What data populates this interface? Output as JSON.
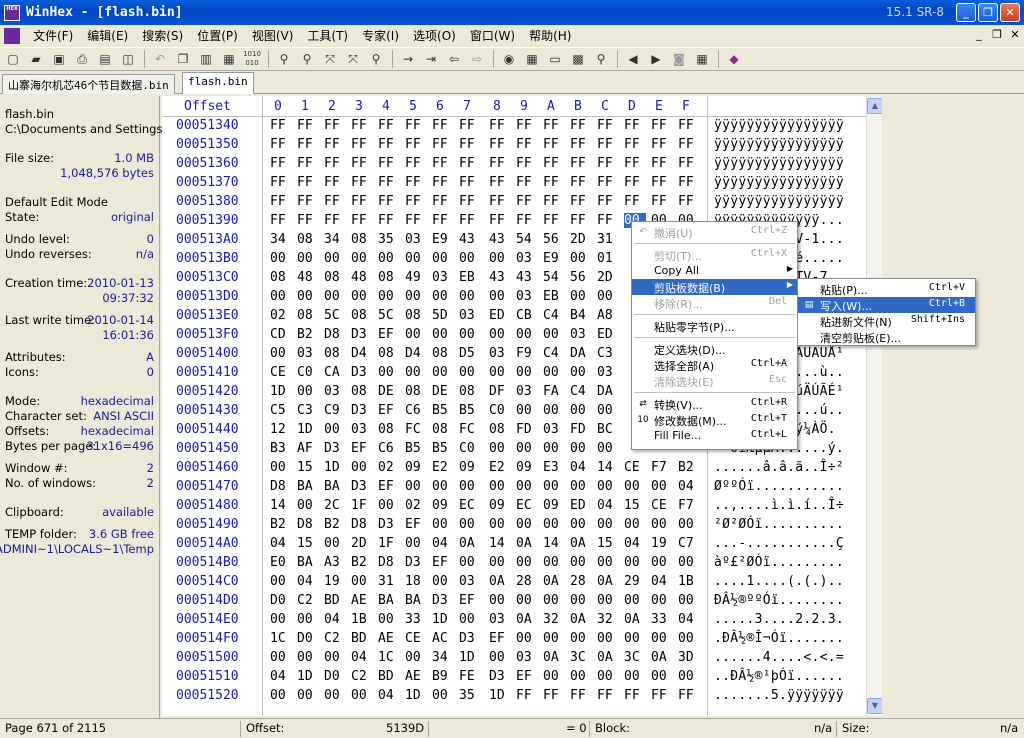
{
  "window": {
    "title": "WinHex - [flash.bin]",
    "version": "15.1 SR-8",
    "app_icon_text": "HEX",
    "minimize": "_",
    "maximize": "❐",
    "close": "✕"
  },
  "menubar": {
    "items": [
      "文件(F)",
      "编辑(E)",
      "搜索(S)",
      "位置(P)",
      "视图(V)",
      "工具(T)",
      "专家(I)",
      "选项(O)",
      "窗口(W)",
      "帮助(H)"
    ],
    "mdi_minimize": "_",
    "mdi_restore": "❐",
    "mdi_close": "✕"
  },
  "tabs": [
    {
      "label": "山寨海尔机芯46个节目数据.bin",
      "active": false
    },
    {
      "label": "flash.bin",
      "active": true
    }
  ],
  "left_panel": {
    "filename": "flash.bin",
    "path": "C:\\Documents and Settings",
    "file_size_label": "File size:",
    "file_size_mb": "1.0 MB",
    "file_size_bytes": "1,048,576 bytes",
    "edit_mode": "Default Edit Mode",
    "state_label": "State:",
    "state_value": "original",
    "undo_level_label": "Undo level:",
    "undo_level_value": "0",
    "undo_reverses_label": "Undo reverses:",
    "undo_reverses_value": "n/a",
    "creation_label": "Creation time:",
    "creation_date": "2010-01-13",
    "creation_time": "09:37:32",
    "lastwrite_label": "Last write time:",
    "lastwrite_date": "2010-01-14",
    "lastwrite_time": "16:01:36",
    "attributes_label": "Attributes:",
    "attributes_value": "A",
    "icons_label": "Icons:",
    "icons_value": "0",
    "mode_label": "Mode:",
    "mode_value": "hexadecimal",
    "charset_label": "Character set:",
    "charset_value": "ANSI ASCII",
    "offsets_label": "Offsets:",
    "offsets_value": "hexadecimal",
    "bpp_label": "Bytes per page:",
    "bpp_value": "31x16=496",
    "window_no_label": "Window #:",
    "window_no_value": "2",
    "no_windows_label": "No. of windows:",
    "no_windows_value": "2",
    "clipboard_label": "Clipboard:",
    "clipboard_value": "available",
    "temp_label": "TEMP folder:",
    "temp_free": "3.6 GB free",
    "temp_path": "ADMINI~1\\LOCALS~1\\Temp"
  },
  "hex": {
    "offset_header": "Offset",
    "col_headers": [
      "0",
      "1",
      "2",
      "3",
      "4",
      "5",
      "6",
      "7",
      "8",
      "9",
      "A",
      "B",
      "C",
      "D",
      "E",
      "F"
    ],
    "rows": [
      {
        "off": "00051340",
        "bytes": "FF FF FF FF FF FF FF FF FF FF FF FF FF FF FF FF",
        "ascii": "ÿÿÿÿÿÿÿÿÿÿÿÿÿÿÿÿ"
      },
      {
        "off": "00051350",
        "bytes": "FF FF FF FF FF FF FF FF FF FF FF FF FF FF FF FF",
        "ascii": "ÿÿÿÿÿÿÿÿÿÿÿÿÿÿÿÿ"
      },
      {
        "off": "00051360",
        "bytes": "FF FF FF FF FF FF FF FF FF FF FF FF FF FF FF FF",
        "ascii": "ÿÿÿÿÿÿÿÿÿÿÿÿÿÿÿÿ"
      },
      {
        "off": "00051370",
        "bytes": "FF FF FF FF FF FF FF FF FF FF FF FF FF FF FF FF",
        "ascii": "ÿÿÿÿÿÿÿÿÿÿÿÿÿÿÿÿ"
      },
      {
        "off": "00051380",
        "bytes": "FF FF FF FF FF FF FF FF FF FF FF FF FF FF FF FF",
        "ascii": "ÿÿÿÿÿÿÿÿÿÿÿÿÿÿÿÿ"
      },
      {
        "off": "00051390",
        "bytes": "FF FF FF FF FF FF FF FF FF FF FF FF FF 00 00 00",
        "ascii": "ÿÿÿÿÿÿÿÿÿÿÿÿÿ..."
      },
      {
        "off": "000513A0",
        "bytes": "34 08 34 08 35 03 E9 43 43 54 56 2D 31",
        "ascii": "4.4.5.éCCTV-1..."
      },
      {
        "off": "000513B0",
        "bytes": "00 00 00 00 00 00 00 00 00 03 E9 00 01",
        "ascii": "..........é....."
      },
      {
        "off": "000513C0",
        "bytes": "08 48 08 48 08 49 03 EB 43 43 54 56 2D",
        "ascii": ".H.H.I.ëCCTV-7.."
      },
      {
        "off": "000513D0",
        "bytes": "00 00 00 00 00 00 00 00 00 03 EB 00 00",
        "ascii": "..........ë....."
      },
      {
        "off": "000513E0",
        "bytes": "02 08 5C 08 5C 08 5D 03 ED CB C4 B4 A8",
        "ascii": "..\\.\\.].íËÄ´¨..."
      },
      {
        "off": "000513F0",
        "bytes": "CD B2 D8 D3 EF 00 00 00 00 00 00 03 ED",
        "ascii": "Í²ØÓï.......í..."
      },
      {
        "off": "00051400",
        "bytes": "00 03 08 D4 08 D4 08 D5 03 F9 C4 DA C3",
        "ascii": "...Ô.Ô.Õ.ùÄÚÃÛÅ¹"
      },
      {
        "off": "00051410",
        "bytes": "CE C0 CA D3 00 00 00 00 00 00 00 00 03",
        "ascii": "ÎÀÊÓ.........ù.."
      },
      {
        "off": "00051420",
        "bytes": "1D 00 03 08 DE 08 DE 08 DF 03 FA C4 DA",
        "ascii": "....Þ.Þ.ß.úÄÚÃÉ¹"
      },
      {
        "off": "00051430",
        "bytes": "C5 C3 C9 D3 EF C6 B5 B5 C0 00 00 00 00",
        "ascii": "ÅÃÉÓïÆµµÀ....ú.."
      },
      {
        "off": "00051440",
        "bytes": "12 1D 00 03 08 FC 08 FC 08 FD 03 FD BC",
        "ascii": "....ü.ü.ý.ý¼ÀÖ."
      },
      {
        "off": "00051450",
        "bytes": "B3 AF D3 EF C6 B5 B5 C0 00 00 00 00 00",
        "ascii": "³¯ÓïÆµµÀ......ý."
      },
      {
        "off": "00051460",
        "bytes": "00 15 1D 00 02 09 E2 09 E2 09 E3 04 14 CE F7 B2",
        "ascii": "......â.â.ã..Î÷²"
      },
      {
        "off": "00051470",
        "bytes": "D8 BA BA D3 EF 00 00 00 00 00 00 00 00 00 00 04",
        "ascii": "ØººÓï..........."
      },
      {
        "off": "00051480",
        "bytes": "14 00 2C 1F 00 02 09 EC 09 EC 09 ED 04 15 CE F7",
        "ascii": "..,....ì.ì.í..Î÷"
      },
      {
        "off": "00051490",
        "bytes": "B2 D8 B2 D8 D3 EF 00 00 00 00 00 00 00 00 00 00",
        "ascii": "²Ø²ØÓï.........."
      },
      {
        "off": "000514A0",
        "bytes": "04 15 00 2D 1F 00 04 0A 14 0A 14 0A 15 04 19 C7",
        "ascii": "...-...........Ç"
      },
      {
        "off": "000514B0",
        "bytes": "E0 BA A3 B2 D8 D3 EF 00 00 00 00 00 00 00 00 00",
        "ascii": "àº£²ØÓï........."
      },
      {
        "off": "000514C0",
        "bytes": "00 04 19 00 31 18 00 03 0A 28 0A 28 0A 29 04 1B",
        "ascii": "....1....(.(.).."
      },
      {
        "off": "000514D0",
        "bytes": "D0 C2 BD AE BA BA D3 EF 00 00 00 00 00 00 00 00",
        "ascii": "ÐÂ½®ººÓï........"
      },
      {
        "off": "000514E0",
        "bytes": "00 00 04 1B 00 33 1D 00 03 0A 32 0A 32 0A 33 04",
        "ascii": ".....3....2.2.3."
      },
      {
        "off": "000514F0",
        "bytes": "1C D0 C2 BD AE CE AC D3 EF 00 00 00 00 00 00 00",
        "ascii": ".ÐÂ½®Î¬Óï......."
      },
      {
        "off": "00051500",
        "bytes": "00 00 00 04 1C 00 34 1D 00 03 0A 3C 0A 3C 0A 3D",
        "ascii": "......4....<.<.="
      },
      {
        "off": "00051510",
        "bytes": "04 1D D0 C2 BD AE B9 FE D3 EF 00 00 00 00 00 00",
        "ascii": "..ÐÂ½®¹þÓï......"
      },
      {
        "off": "00051520",
        "bytes": "00 00 00 00 04 1D 00 35 1D FF FF FF FF FF FF FF",
        "ascii": ".......5.ÿÿÿÿÿÿÿ"
      }
    ]
  },
  "context_menu": {
    "items": [
      {
        "label": "撤消(U)",
        "shortcut": "Ctrl+Z",
        "disabled": true,
        "icon": "↶"
      },
      {
        "sep": true
      },
      {
        "label": "剪切(T)...",
        "shortcut": "Ctrl+X",
        "disabled": true
      },
      {
        "label": "Copy All",
        "shortcut": "",
        "arrow": true
      },
      {
        "label": "剪贴板数据(B)",
        "shortcut": "",
        "arrow": true,
        "highlight": true
      },
      {
        "label": "移除(R)...",
        "shortcut": "Del",
        "disabled": true
      },
      {
        "sep": true
      },
      {
        "label": "粘贴零字节(P)...",
        "shortcut": ""
      },
      {
        "sep": true
      },
      {
        "label": "定义选块(D)...",
        "shortcut": ""
      },
      {
        "label": "选择全部(A)",
        "shortcut": "Ctrl+A"
      },
      {
        "label": "清除选块(E)",
        "shortcut": "Esc",
        "disabled": true
      },
      {
        "sep": true
      },
      {
        "label": "转换(V)...",
        "shortcut": "Ctrl+R",
        "icon": "⇄"
      },
      {
        "label": "修改数据(M)...",
        "shortcut": "Ctrl+T",
        "icon": "10"
      },
      {
        "label": "Fill File...",
        "shortcut": "Ctrl+L"
      }
    ]
  },
  "submenu": {
    "items": [
      {
        "label": "粘贴(P)...",
        "shortcut": "Ctrl+V"
      },
      {
        "label": "写入(W)...",
        "shortcut": "Ctrl+B",
        "highlight": true,
        "icon": "▤"
      },
      {
        "label": "粘进新文件(N)",
        "shortcut": "Shift+Ins"
      },
      {
        "label": "清空剪贴板(E)...",
        "shortcut": ""
      }
    ]
  },
  "statusbar": {
    "page": "Page 671 of 2115",
    "offset_label": "Offset:",
    "offset_value": "5139D",
    "eq_value": "= 0",
    "block_label": "Block:",
    "block_value": "n/a",
    "size_label": "Size:",
    "size_value": "n/a"
  }
}
